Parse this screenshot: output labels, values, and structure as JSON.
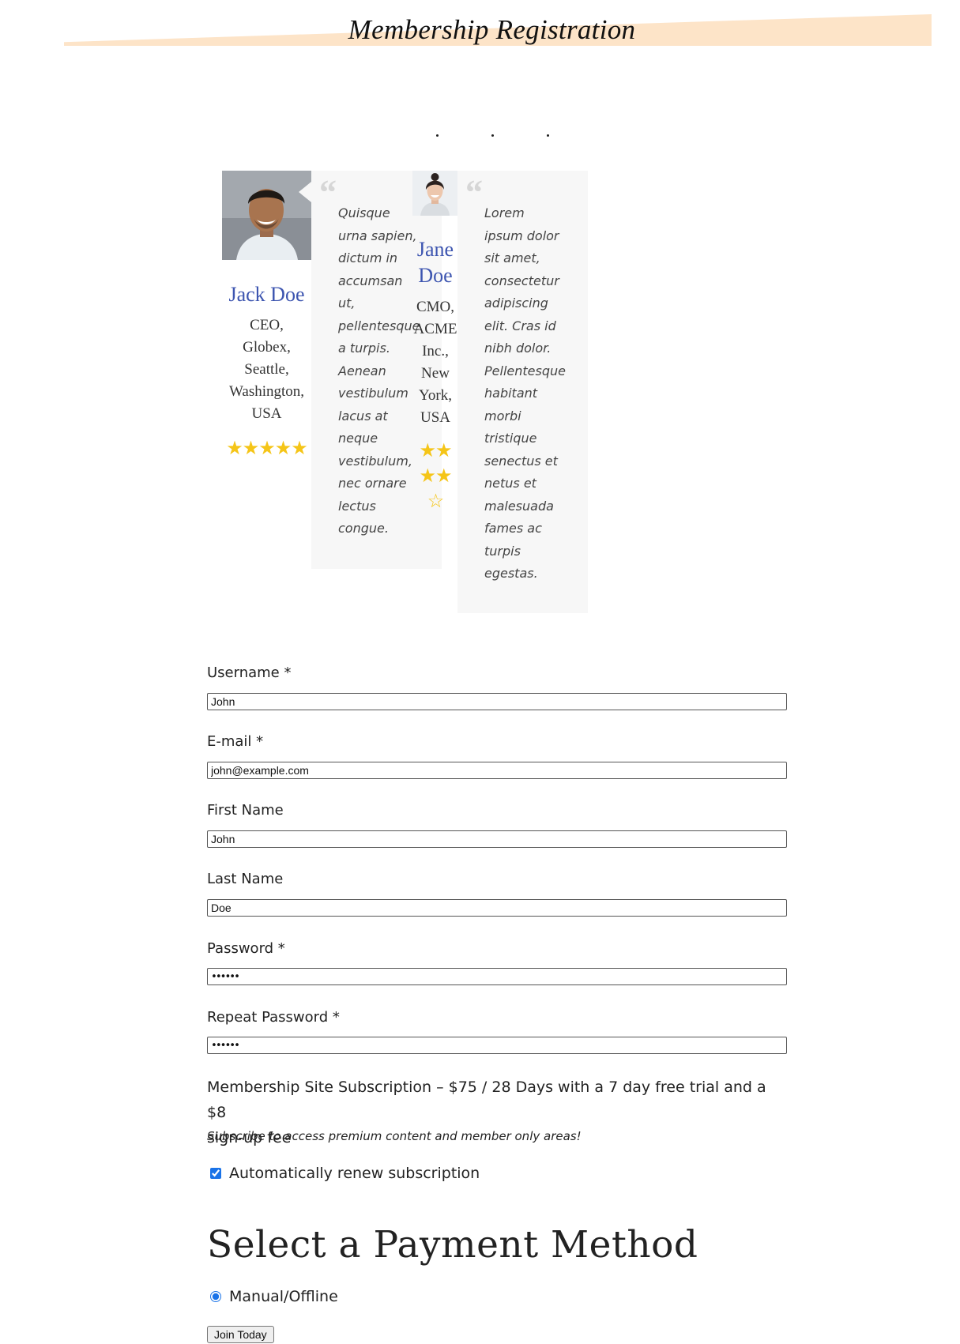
{
  "header": {
    "title": "Membership Registration"
  },
  "testimonials": [
    {
      "name": "Jack Doe",
      "meta": [
        "CEO,",
        "Globex,",
        "Seattle,",
        "Washington,",
        "USA"
      ],
      "rating": 5,
      "stars": "★★★★★",
      "quote": [
        "Quisque",
        "urna sapien,",
        "dictum in",
        "accumsan",
        "ut,",
        "pellentesque",
        "a turpis.",
        "Aenean",
        "vestibulum",
        "lacus at",
        "neque",
        "vestibulum,",
        "nec ornare",
        "lectus",
        "congue."
      ]
    },
    {
      "name": [
        "Jane",
        "Doe"
      ],
      "meta": [
        "CMO,",
        "ACME",
        "Inc.,",
        "New",
        "York,",
        "USA"
      ],
      "rating": 4,
      "stars_row1": "★★",
      "stars_row2": "★★",
      "stars_row3": "☆",
      "quote": [
        "Lorem",
        "ipsum dolor",
        "sit amet,",
        "consectetur",
        "adipiscing",
        "elit. Cras id",
        "nibh dolor.",
        "Pellentesque",
        "habitant",
        "morbi",
        "tristique",
        "senectus et",
        "netus et",
        "malesuada",
        "fames ac",
        "turpis",
        "egestas."
      ]
    }
  ],
  "form": {
    "username_label": "Username *",
    "username_value": "John",
    "email_label": "E-mail *",
    "email_value": "john@example.com",
    "first_name_label": "First Name",
    "first_name_value": "John",
    "last_name_label": "Last Name",
    "last_name_value": "Doe",
    "password_label": "Password *",
    "password_value": "••••••",
    "repeat_password_label": "Repeat Password *",
    "repeat_password_value": "••••••"
  },
  "subscription": {
    "line1": "Membership Site Subscription – $75 / 28 Days with a 7 day free trial and a $8",
    "line2": "sign-up fee",
    "description": "Subscribe to access premium content and member only areas!",
    "auto_renew_label": "Automatically renew subscription",
    "auto_renew_checked": true
  },
  "payment": {
    "heading": "Select a Payment Method",
    "method_label": "Manual/Offline",
    "method_selected": true
  },
  "submit_label": "Join Today",
  "colors": {
    "name_blue": "#3d55b0",
    "star_gold": "#f5c518",
    "band_peach": "#fde4c8"
  }
}
